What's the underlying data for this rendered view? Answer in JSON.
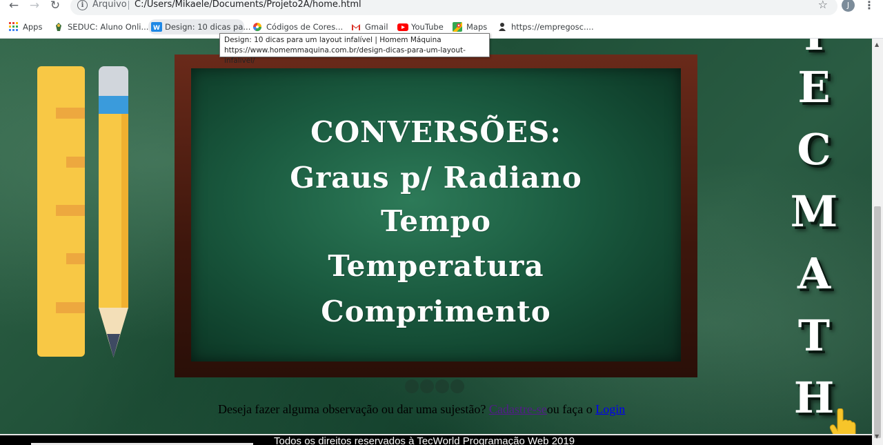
{
  "browser": {
    "scheme_label": "Arquivo",
    "url": "C:/Users/Mikaele/Documents/Projeto2A/home.html",
    "avatar_letter": "J",
    "bookmarks": [
      {
        "label": "Apps",
        "icon": "apps-grid-icon"
      },
      {
        "label": "SEDUC: Aluno Onli...",
        "icon": "seduc-icon"
      },
      {
        "label": "Design: 10 dicas pa...",
        "icon": "homem-maquina-icon"
      },
      {
        "label": "Códigos de Cores...",
        "icon": "color-wheel-icon"
      },
      {
        "label": "Gmail",
        "icon": "gmail-icon"
      },
      {
        "label": "YouTube",
        "icon": "youtube-icon"
      },
      {
        "label": "Maps",
        "icon": "maps-icon"
      },
      {
        "label": "https://empregosc....",
        "icon": "site-icon"
      }
    ],
    "tooltip": {
      "title": "Design: 10 dicas para um layout infalível | Homem Máquina",
      "url": "https://www.homemmaquina.com.br/design-dicas-para-um-layout-infalivel/"
    }
  },
  "page": {
    "board_lines": [
      "CONVERSÕES:",
      "Graus p/ Radiano",
      "Tempo",
      "Temperatura",
      "Comprimento"
    ],
    "vertical_title": [
      "E",
      "C",
      "M",
      "A",
      "T",
      "H"
    ],
    "cta": {
      "question": "Deseja fazer alguma observação ou dar uma sujestão? ",
      "register_link": "Cadastre-se",
      "middle": "ou faça o ",
      "login_link": "Login"
    },
    "footer": "Todos os direitos reservados à TecWorld Programação Web 2019",
    "colors": {
      "chalkboard": "#1a5a3f",
      "frame": "#5a2314",
      "ruler": "#f8c845",
      "pencil_band": "#3a9bdc"
    }
  }
}
